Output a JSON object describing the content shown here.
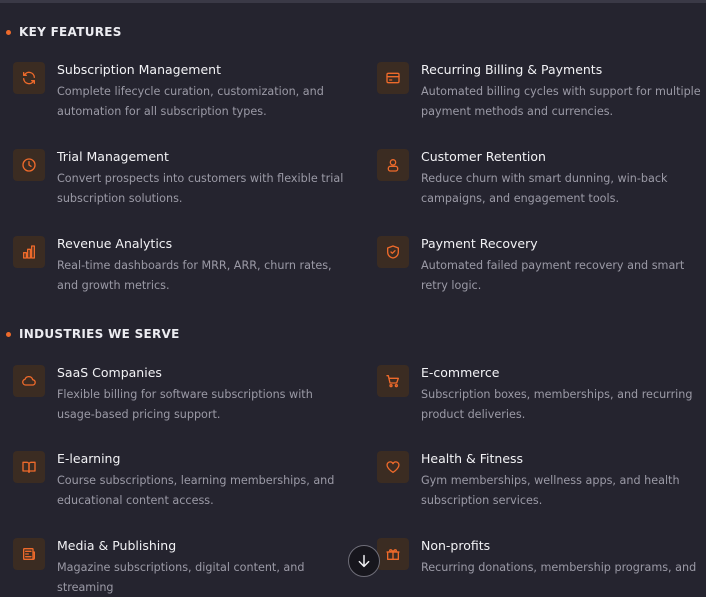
{
  "sections": [
    {
      "title": "KEY FEATURES",
      "items": [
        {
          "title": "Subscription Management",
          "desc": "Complete lifecycle curation, customization, and automation for all subscription types.",
          "icon": "refresh-icon"
        },
        {
          "title": "Recurring Billing & Payments",
          "desc": "Automated billing cycles with support for multiple payment methods and currencies.",
          "icon": "credit-card-icon"
        },
        {
          "title": "Trial Management",
          "desc": "Convert prospects into customers with flexible trial subscription solutions.",
          "icon": "clock-icon"
        },
        {
          "title": "Customer Retention",
          "desc": "Reduce churn with smart dunning, win-back campaigns, and engagement tools.",
          "icon": "user-retention-icon"
        },
        {
          "title": "Revenue Analytics",
          "desc": "Real-time dashboards for MRR, ARR, churn rates, and growth metrics.",
          "icon": "bar-chart-icon"
        },
        {
          "title": "Payment Recovery",
          "desc": "Automated failed payment recovery and smart retry logic.",
          "icon": "shield-check-icon"
        }
      ]
    },
    {
      "title": "INDUSTRIES WE SERVE",
      "items": [
        {
          "title": "SaaS Companies",
          "desc": "Flexible billing for software subscriptions with usage-based pricing support.",
          "icon": "cloud-icon"
        },
        {
          "title": "E-commerce",
          "desc": "Subscription boxes, memberships, and recurring product deliveries.",
          "icon": "shopping-cart-icon"
        },
        {
          "title": "E-learning",
          "desc": "Course subscriptions, learning memberships, and educational content access.",
          "icon": "book-icon"
        },
        {
          "title": "Health & Fitness",
          "desc": "Gym memberships, wellness apps, and health subscription services.",
          "icon": "heart-icon"
        },
        {
          "title": "Media & Publishing",
          "desc": "Magazine subscriptions, digital content, and streaming",
          "icon": "newspaper-icon"
        },
        {
          "title": "Non-profits",
          "desc": "Recurring donations, membership programs, and",
          "icon": "gift-icon"
        }
      ]
    }
  ],
  "colors": {
    "accent": "#ee6a2b",
    "background": "#25242f",
    "icon_bg": "#3b2c22"
  }
}
